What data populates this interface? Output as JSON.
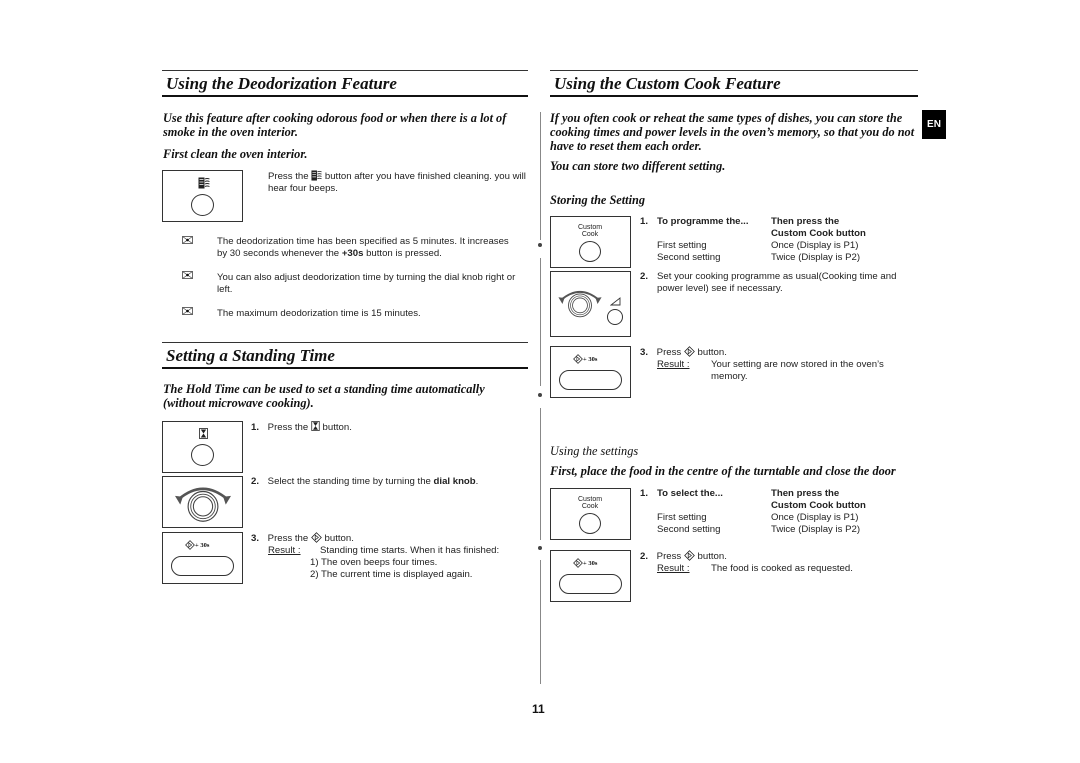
{
  "left": {
    "deodorization": {
      "title": "Using the Deodorization Feature",
      "intro": "Use this feature after cooking odorous food or when there is a lot of smoke in the oven interior.",
      "first_clean": "First clean the oven interior.",
      "press_text_a": "Press the",
      "press_text_b": "button after you have finished cleaning. you will hear four beeps.",
      "notes": [
        "The deodorization time has been specified as 5 minutes. It increases by 30 seconds whenever the",
        "You can also adjust deodorization time by turning the dial knob right or left.",
        "The maximum deodorization time is 15 minutes."
      ],
      "note1_bold": "+30s",
      "note1_tail": "button is pressed.",
      "button_icon": "deodorize-icon"
    },
    "standing": {
      "title": "Setting a Standing Time",
      "intro": "The Hold Time can be used to set a standing time automatically (without microwave cooking).",
      "steps": [
        {
          "num": "1.",
          "text_a": "Press the",
          "text_b": "button."
        },
        {
          "num": "2.",
          "text_a": "Select the standing time by turning the",
          "bold": "dial knob",
          "text_b": "."
        },
        {
          "num": "3.",
          "text_a": "Press the",
          "text_b": "button."
        }
      ],
      "result_label": "Result :",
      "result_text": "Standing time starts. When it has finished:",
      "result_items": [
        "1)  The oven beeps four times.",
        "2)  The current time is displayed again."
      ],
      "start_button_label": "+ 30s"
    }
  },
  "right": {
    "custom_cook": {
      "title": "Using the Custom Cook Feature",
      "intro": "If you often cook or reheat the same types of dishes, you can store the cooking times and power levels in the oven’s memory, so that you do not have to reset them each order.",
      "two_settings": "You can store two different setting.",
      "storing_heading": "Storing the Setting",
      "button_label_line1": "Custom",
      "button_label_line2": "Cook",
      "store_step1": {
        "num": "1.",
        "col1_header": "To programme the...",
        "col2_header_1": "Then press the",
        "col2_header_2": "Custom Cook button",
        "rows": [
          {
            "setting": "First setting",
            "press": "Once (Display is P1)"
          },
          {
            "setting": "Second setting",
            "press": "Twice (Display is P2)"
          }
        ]
      },
      "store_step2": {
        "num": "2.",
        "text": "Set your cooking programme as usual(Cooking time and power level) see if necessary."
      },
      "store_step3": {
        "num": "3.",
        "text_a": "Press",
        "text_b": "button.",
        "result_label": "Result :",
        "result_text": "Your setting are now stored in the oven’s memory."
      },
      "using_heading": "Using the settings",
      "using_intro": "First, place the food in the centre of the turntable and close the door",
      "use_step1": {
        "num": "1.",
        "col1_header": "To select the...",
        "col2_header_1": "Then press the",
        "col2_header_2": "Custom Cook button",
        "rows": [
          {
            "setting": "First setting",
            "press": "Once (Display is P1)"
          },
          {
            "setting": "Second setting",
            "press": "Twice (Display is P2)"
          }
        ]
      },
      "use_step2": {
        "num": "2.",
        "text_a": "Press",
        "text_b": "button.",
        "result_label": "Result :",
        "result_text": "The food is cooked as requested."
      },
      "start_button_label": "+ 30s"
    }
  },
  "language_badge": "EN",
  "page_number": "11"
}
